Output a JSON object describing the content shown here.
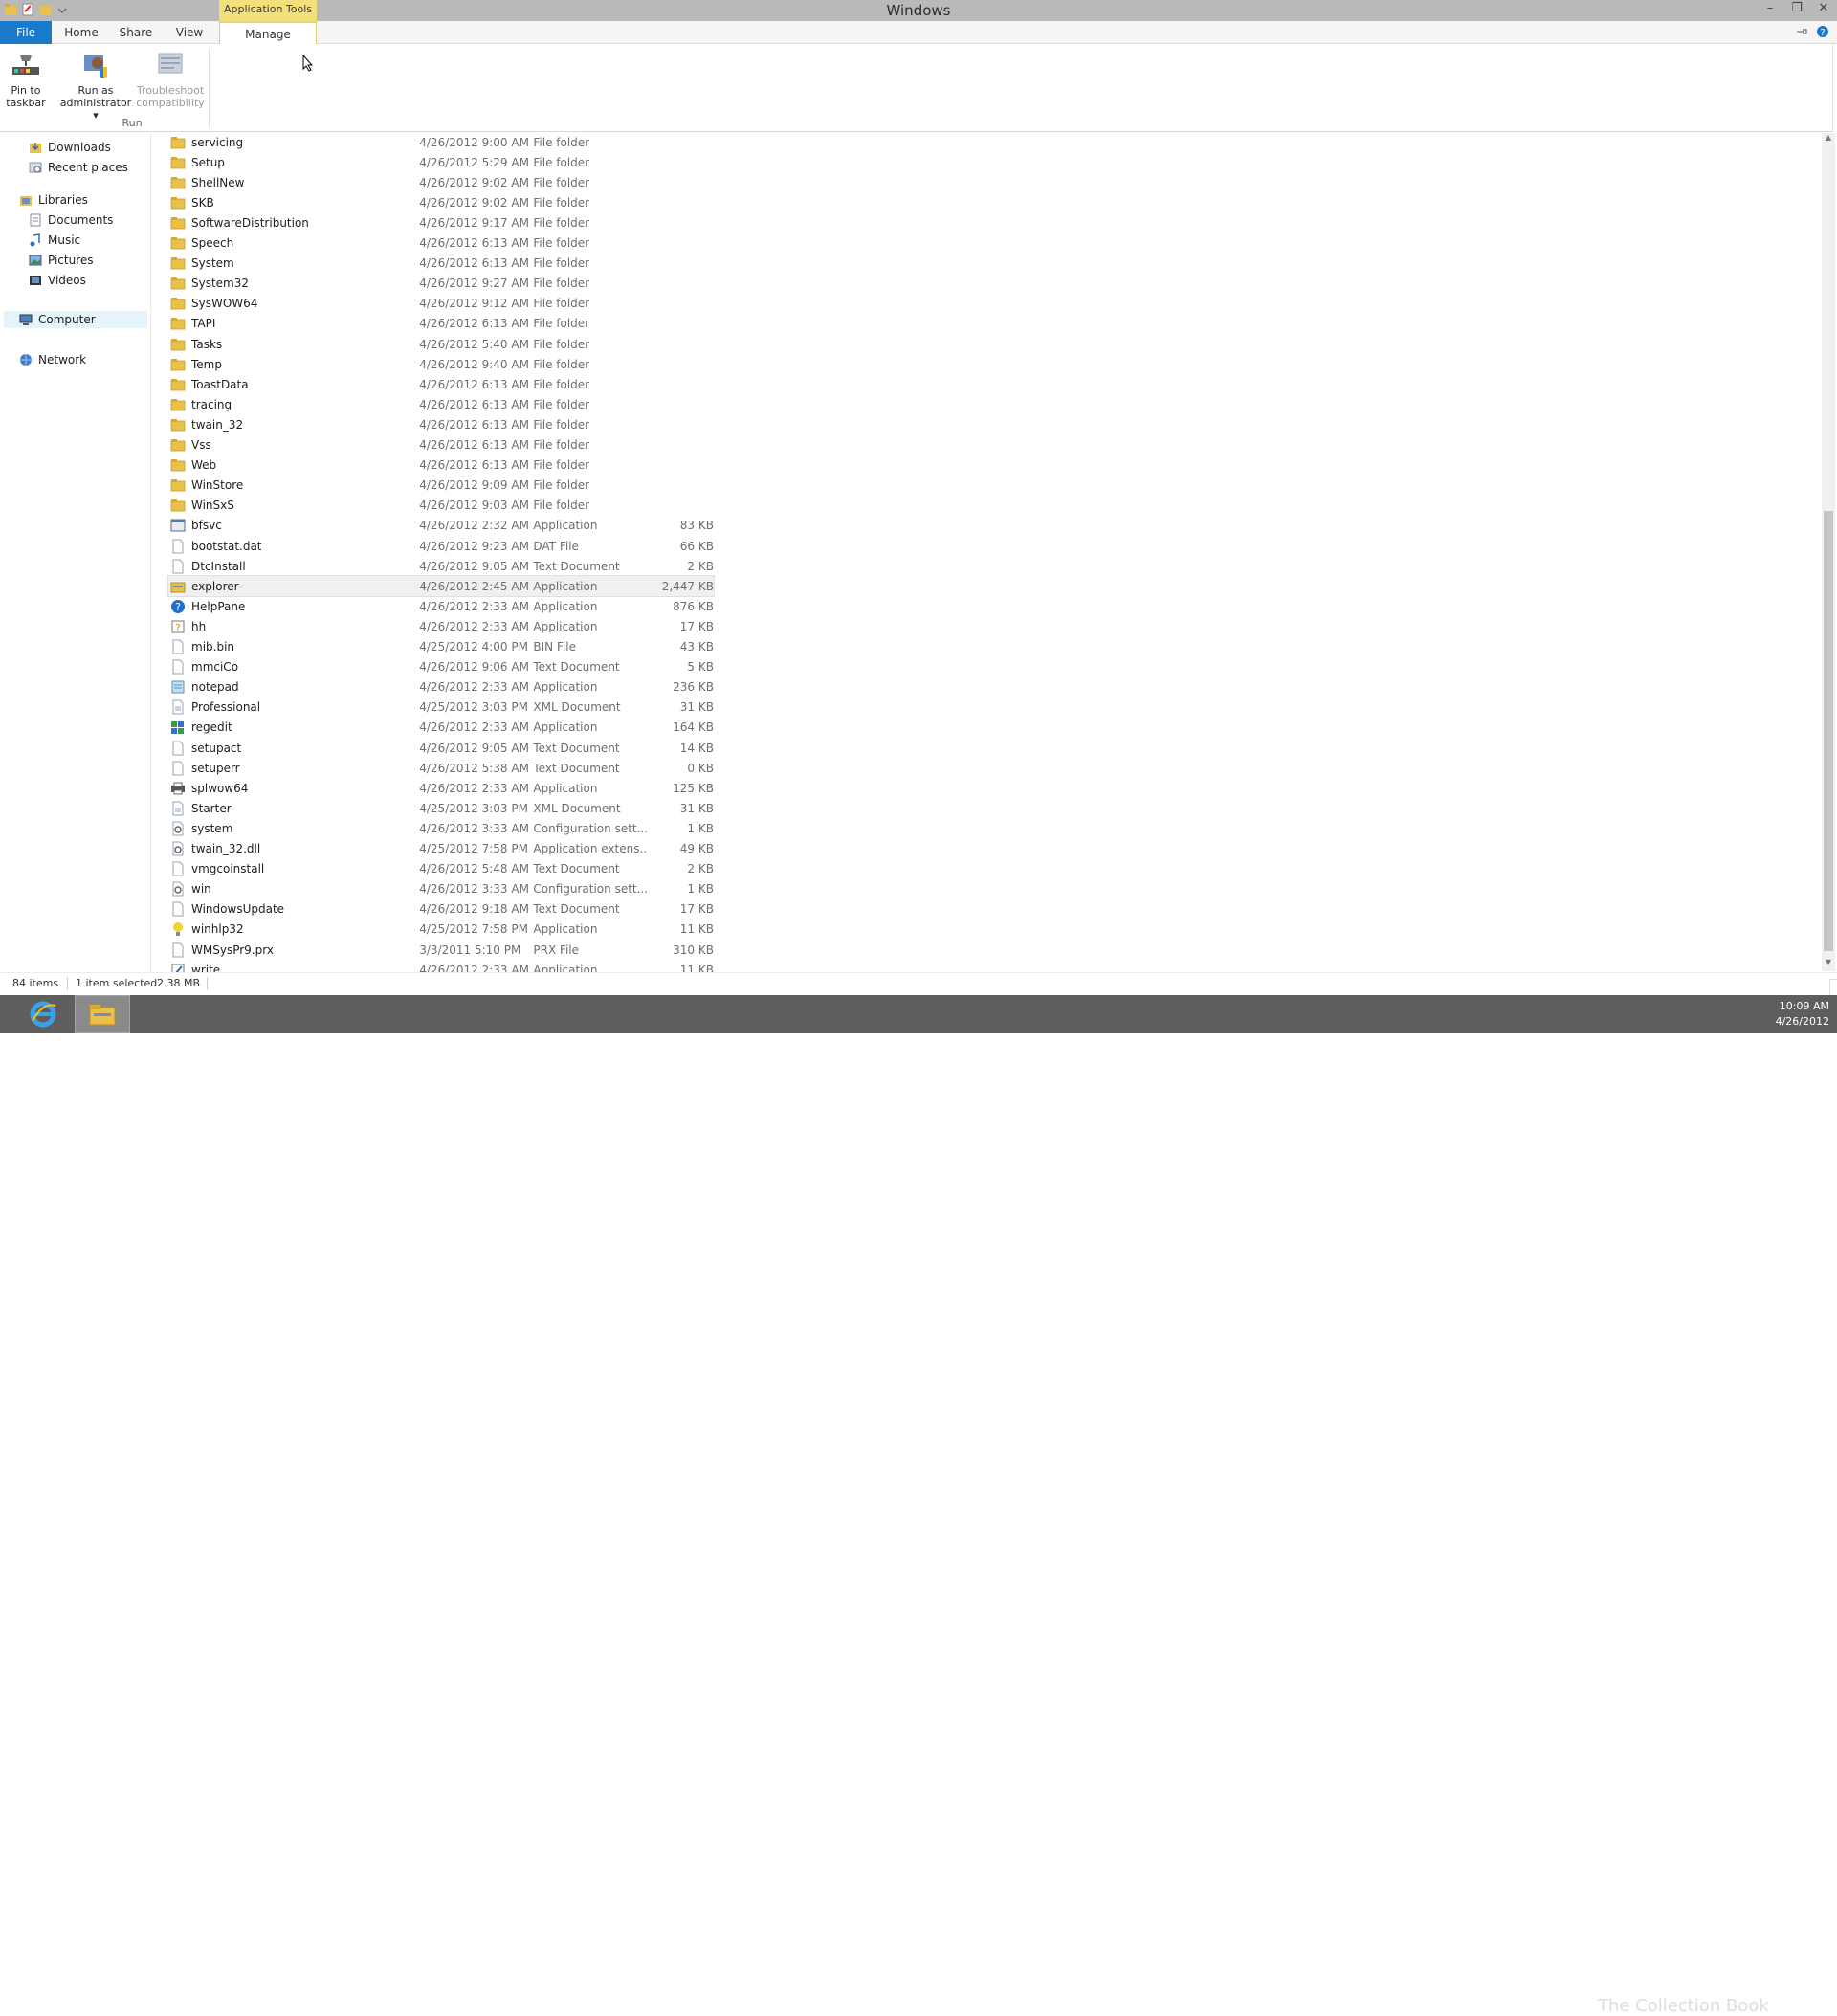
{
  "window": {
    "title": "Windows",
    "context_tab_header": "Application Tools"
  },
  "ribbon_tabs": {
    "file": "File",
    "home": "Home",
    "share": "Share",
    "view": "View",
    "manage": "Manage"
  },
  "ribbon": {
    "pin_label_1": "Pin to",
    "pin_label_2": "taskbar",
    "runas_label_1": "Run as",
    "runas_label_2": "administrator",
    "troubleshoot_label_1": "Troubleshoot",
    "troubleshoot_label_2": "compatibility",
    "group_run": "Run"
  },
  "nav": {
    "downloads": "Downloads",
    "recent": "Recent places",
    "libraries": "Libraries",
    "documents": "Documents",
    "music": "Music",
    "pictures": "Pictures",
    "videos": "Videos",
    "computer": "Computer",
    "network": "Network"
  },
  "files": [
    {
      "name": "servicing",
      "date": "4/26/2012 9:00 AM",
      "type": "File folder",
      "size": "",
      "icon": "folder"
    },
    {
      "name": "Setup",
      "date": "4/26/2012 5:29 AM",
      "type": "File folder",
      "size": "",
      "icon": "folder"
    },
    {
      "name": "ShellNew",
      "date": "4/26/2012 9:02 AM",
      "type": "File folder",
      "size": "",
      "icon": "folder"
    },
    {
      "name": "SKB",
      "date": "4/26/2012 9:02 AM",
      "type": "File folder",
      "size": "",
      "icon": "folder"
    },
    {
      "name": "SoftwareDistribution",
      "date": "4/26/2012 9:17 AM",
      "type": "File folder",
      "size": "",
      "icon": "folder"
    },
    {
      "name": "Speech",
      "date": "4/26/2012 6:13 AM",
      "type": "File folder",
      "size": "",
      "icon": "folder"
    },
    {
      "name": "System",
      "date": "4/26/2012 6:13 AM",
      "type": "File folder",
      "size": "",
      "icon": "folder"
    },
    {
      "name": "System32",
      "date": "4/26/2012 9:27 AM",
      "type": "File folder",
      "size": "",
      "icon": "folder"
    },
    {
      "name": "SysWOW64",
      "date": "4/26/2012 9:12 AM",
      "type": "File folder",
      "size": "",
      "icon": "folder"
    },
    {
      "name": "TAPI",
      "date": "4/26/2012 6:13 AM",
      "type": "File folder",
      "size": "",
      "icon": "folder"
    },
    {
      "name": "Tasks",
      "date": "4/26/2012 5:40 AM",
      "type": "File folder",
      "size": "",
      "icon": "folder"
    },
    {
      "name": "Temp",
      "date": "4/26/2012 9:40 AM",
      "type": "File folder",
      "size": "",
      "icon": "folder"
    },
    {
      "name": "ToastData",
      "date": "4/26/2012 6:13 AM",
      "type": "File folder",
      "size": "",
      "icon": "folder"
    },
    {
      "name": "tracing",
      "date": "4/26/2012 6:13 AM",
      "type": "File folder",
      "size": "",
      "icon": "folder"
    },
    {
      "name": "twain_32",
      "date": "4/26/2012 6:13 AM",
      "type": "File folder",
      "size": "",
      "icon": "folder"
    },
    {
      "name": "Vss",
      "date": "4/26/2012 6:13 AM",
      "type": "File folder",
      "size": "",
      "icon": "folder"
    },
    {
      "name": "Web",
      "date": "4/26/2012 6:13 AM",
      "type": "File folder",
      "size": "",
      "icon": "folder"
    },
    {
      "name": "WinStore",
      "date": "4/26/2012 9:09 AM",
      "type": "File folder",
      "size": "",
      "icon": "folder"
    },
    {
      "name": "WinSxS",
      "date": "4/26/2012 9:03 AM",
      "type": "File folder",
      "size": "",
      "icon": "folder"
    },
    {
      "name": "bfsvc",
      "date": "4/26/2012 2:32 AM",
      "type": "Application",
      "size": "83 KB",
      "icon": "app"
    },
    {
      "name": "bootstat.dat",
      "date": "4/26/2012 9:23 AM",
      "type": "DAT File",
      "size": "66 KB",
      "icon": "file"
    },
    {
      "name": "DtcInstall",
      "date": "4/26/2012 9:05 AM",
      "type": "Text Document",
      "size": "2 KB",
      "icon": "file"
    },
    {
      "name": "explorer",
      "date": "4/26/2012 2:45 AM",
      "type": "Application",
      "size": "2,447 KB",
      "icon": "explorer",
      "selected": true
    },
    {
      "name": "HelpPane",
      "date": "4/26/2012 2:33 AM",
      "type": "Application",
      "size": "876 KB",
      "icon": "help"
    },
    {
      "name": "hh",
      "date": "4/26/2012 2:33 AM",
      "type": "Application",
      "size": "17 KB",
      "icon": "hh"
    },
    {
      "name": "mib.bin",
      "date": "4/25/2012 4:00 PM",
      "type": "BIN File",
      "size": "43 KB",
      "icon": "file"
    },
    {
      "name": "mmciCo",
      "date": "4/26/2012 9:06 AM",
      "type": "Text Document",
      "size": "5 KB",
      "icon": "file"
    },
    {
      "name": "notepad",
      "date": "4/26/2012 2:33 AM",
      "type": "Application",
      "size": "236 KB",
      "icon": "notepad"
    },
    {
      "name": "Professional",
      "date": "4/25/2012 3:03 PM",
      "type": "XML Document",
      "size": "31 KB",
      "icon": "xml"
    },
    {
      "name": "regedit",
      "date": "4/26/2012 2:33 AM",
      "type": "Application",
      "size": "164 KB",
      "icon": "regedit"
    },
    {
      "name": "setupact",
      "date": "4/26/2012 9:05 AM",
      "type": "Text Document",
      "size": "14 KB",
      "icon": "file"
    },
    {
      "name": "setuperr",
      "date": "4/26/2012 5:38 AM",
      "type": "Text Document",
      "size": "0 KB",
      "icon": "file"
    },
    {
      "name": "splwow64",
      "date": "4/26/2012 2:33 AM",
      "type": "Application",
      "size": "125 KB",
      "icon": "printer"
    },
    {
      "name": "Starter",
      "date": "4/25/2012 3:03 PM",
      "type": "XML Document",
      "size": "31 KB",
      "icon": "xml"
    },
    {
      "name": "system",
      "date": "4/26/2012 3:33 AM",
      "type": "Configuration sett...",
      "size": "1 KB",
      "icon": "config"
    },
    {
      "name": "twain_32.dll",
      "date": "4/25/2012 7:58 PM",
      "type": "Application extens...",
      "size": "49 KB",
      "icon": "config"
    },
    {
      "name": "vmgcoinstall",
      "date": "4/26/2012 5:48 AM",
      "type": "Text Document",
      "size": "2 KB",
      "icon": "file"
    },
    {
      "name": "win",
      "date": "4/26/2012 3:33 AM",
      "type": "Configuration sett...",
      "size": "1 KB",
      "icon": "config"
    },
    {
      "name": "WindowsUpdate",
      "date": "4/26/2012 9:18 AM",
      "type": "Text Document",
      "size": "17 KB",
      "icon": "file"
    },
    {
      "name": "winhlp32",
      "date": "4/25/2012 7:58 PM",
      "type": "Application",
      "size": "11 KB",
      "icon": "bulb"
    },
    {
      "name": "WMSysPr9.prx",
      "date": "3/3/2011 5:10 PM",
      "type": "PRX File",
      "size": "310 KB",
      "icon": "file"
    },
    {
      "name": "write",
      "date": "4/26/2012 2:33 AM",
      "type": "Application",
      "size": "11 KB",
      "icon": "write"
    }
  ],
  "status": {
    "item_count": "84 items",
    "selection": "1 item selected",
    "selection_size": "2.38 MB"
  },
  "tray": {
    "time": "10:09 AM",
    "date": "4/26/2012"
  },
  "watermark": "The Collection Book",
  "colors": {
    "file_tab": "#1979ca",
    "context_tab": "#f4e07a",
    "folder": "#e8c04a",
    "taskbar": "#5e5e5e"
  }
}
